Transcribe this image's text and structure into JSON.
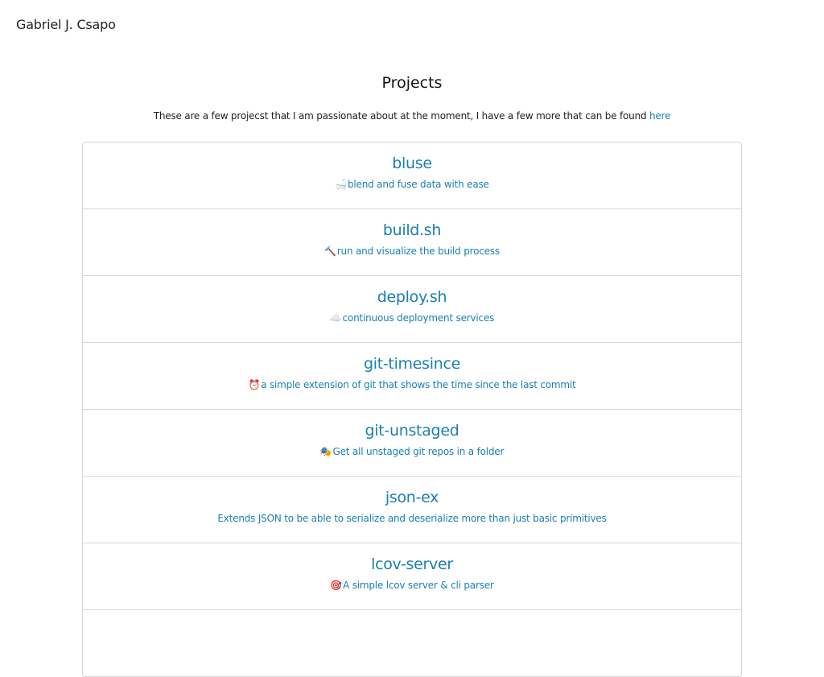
{
  "site": {
    "name": "Gabriel J. Csapo"
  },
  "page": {
    "title": "Projects",
    "intro_text": "These are a few projecst that I am passionate about at the moment, I have a few more that can be found ",
    "intro_link": "here"
  },
  "projects": [
    {
      "name": "bluse",
      "emoji": "🛁",
      "icon": "bathtub-icon",
      "description": "blend and fuse data with ease"
    },
    {
      "name": "build.sh",
      "emoji": "🔨",
      "icon": "hammer-icon",
      "description": "run and visualize the build process"
    },
    {
      "name": "deploy.sh",
      "emoji": "☁️",
      "icon": "cloud-icon",
      "description": "continuous deployment services"
    },
    {
      "name": "git-timesince",
      "emoji": "⏰",
      "icon": "alarm-clock-icon",
      "description": "a simple extension of git that shows the time since the last commit"
    },
    {
      "name": "git-unstaged",
      "emoji": "🎭",
      "icon": "masks-icon",
      "description": "Get all unstaged git repos in a folder"
    },
    {
      "name": "json-ex",
      "emoji": "",
      "icon": "",
      "description": "Extends JSON to be able to serialize and deserialize more than just basic primitives"
    },
    {
      "name": "lcov-server",
      "emoji": "🎯",
      "icon": "target-icon",
      "description": "A simple lcov server & cli parser"
    },
    {
      "name": "",
      "emoji": "",
      "icon": "",
      "description": ""
    }
  ]
}
